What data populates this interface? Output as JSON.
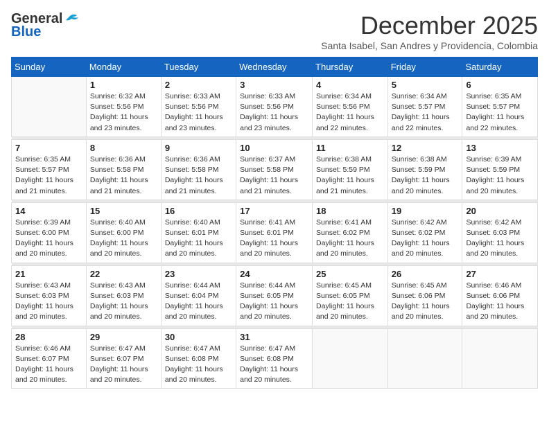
{
  "header": {
    "logo_general": "General",
    "logo_blue": "Blue",
    "month_title": "December 2025",
    "subtitle": "Santa Isabel, San Andres y Providencia, Colombia"
  },
  "weekdays": [
    "Sunday",
    "Monday",
    "Tuesday",
    "Wednesday",
    "Thursday",
    "Friday",
    "Saturday"
  ],
  "weeks": [
    [
      {
        "day": "",
        "info": ""
      },
      {
        "day": "1",
        "info": "Sunrise: 6:32 AM\nSunset: 5:56 PM\nDaylight: 11 hours\nand 23 minutes."
      },
      {
        "day": "2",
        "info": "Sunrise: 6:33 AM\nSunset: 5:56 PM\nDaylight: 11 hours\nand 23 minutes."
      },
      {
        "day": "3",
        "info": "Sunrise: 6:33 AM\nSunset: 5:56 PM\nDaylight: 11 hours\nand 23 minutes."
      },
      {
        "day": "4",
        "info": "Sunrise: 6:34 AM\nSunset: 5:56 PM\nDaylight: 11 hours\nand 22 minutes."
      },
      {
        "day": "5",
        "info": "Sunrise: 6:34 AM\nSunset: 5:57 PM\nDaylight: 11 hours\nand 22 minutes."
      },
      {
        "day": "6",
        "info": "Sunrise: 6:35 AM\nSunset: 5:57 PM\nDaylight: 11 hours\nand 22 minutes."
      }
    ],
    [
      {
        "day": "7",
        "info": "Sunrise: 6:35 AM\nSunset: 5:57 PM\nDaylight: 11 hours\nand 21 minutes."
      },
      {
        "day": "8",
        "info": "Sunrise: 6:36 AM\nSunset: 5:58 PM\nDaylight: 11 hours\nand 21 minutes."
      },
      {
        "day": "9",
        "info": "Sunrise: 6:36 AM\nSunset: 5:58 PM\nDaylight: 11 hours\nand 21 minutes."
      },
      {
        "day": "10",
        "info": "Sunrise: 6:37 AM\nSunset: 5:58 PM\nDaylight: 11 hours\nand 21 minutes."
      },
      {
        "day": "11",
        "info": "Sunrise: 6:38 AM\nSunset: 5:59 PM\nDaylight: 11 hours\nand 21 minutes."
      },
      {
        "day": "12",
        "info": "Sunrise: 6:38 AM\nSunset: 5:59 PM\nDaylight: 11 hours\nand 20 minutes."
      },
      {
        "day": "13",
        "info": "Sunrise: 6:39 AM\nSunset: 5:59 PM\nDaylight: 11 hours\nand 20 minutes."
      }
    ],
    [
      {
        "day": "14",
        "info": "Sunrise: 6:39 AM\nSunset: 6:00 PM\nDaylight: 11 hours\nand 20 minutes."
      },
      {
        "day": "15",
        "info": "Sunrise: 6:40 AM\nSunset: 6:00 PM\nDaylight: 11 hours\nand 20 minutes."
      },
      {
        "day": "16",
        "info": "Sunrise: 6:40 AM\nSunset: 6:01 PM\nDaylight: 11 hours\nand 20 minutes."
      },
      {
        "day": "17",
        "info": "Sunrise: 6:41 AM\nSunset: 6:01 PM\nDaylight: 11 hours\nand 20 minutes."
      },
      {
        "day": "18",
        "info": "Sunrise: 6:41 AM\nSunset: 6:02 PM\nDaylight: 11 hours\nand 20 minutes."
      },
      {
        "day": "19",
        "info": "Sunrise: 6:42 AM\nSunset: 6:02 PM\nDaylight: 11 hours\nand 20 minutes."
      },
      {
        "day": "20",
        "info": "Sunrise: 6:42 AM\nSunset: 6:03 PM\nDaylight: 11 hours\nand 20 minutes."
      }
    ],
    [
      {
        "day": "21",
        "info": "Sunrise: 6:43 AM\nSunset: 6:03 PM\nDaylight: 11 hours\nand 20 minutes."
      },
      {
        "day": "22",
        "info": "Sunrise: 6:43 AM\nSunset: 6:03 PM\nDaylight: 11 hours\nand 20 minutes."
      },
      {
        "day": "23",
        "info": "Sunrise: 6:44 AM\nSunset: 6:04 PM\nDaylight: 11 hours\nand 20 minutes."
      },
      {
        "day": "24",
        "info": "Sunrise: 6:44 AM\nSunset: 6:05 PM\nDaylight: 11 hours\nand 20 minutes."
      },
      {
        "day": "25",
        "info": "Sunrise: 6:45 AM\nSunset: 6:05 PM\nDaylight: 11 hours\nand 20 minutes."
      },
      {
        "day": "26",
        "info": "Sunrise: 6:45 AM\nSunset: 6:06 PM\nDaylight: 11 hours\nand 20 minutes."
      },
      {
        "day": "27",
        "info": "Sunrise: 6:46 AM\nSunset: 6:06 PM\nDaylight: 11 hours\nand 20 minutes."
      }
    ],
    [
      {
        "day": "28",
        "info": "Sunrise: 6:46 AM\nSunset: 6:07 PM\nDaylight: 11 hours\nand 20 minutes."
      },
      {
        "day": "29",
        "info": "Sunrise: 6:47 AM\nSunset: 6:07 PM\nDaylight: 11 hours\nand 20 minutes."
      },
      {
        "day": "30",
        "info": "Sunrise: 6:47 AM\nSunset: 6:08 PM\nDaylight: 11 hours\nand 20 minutes."
      },
      {
        "day": "31",
        "info": "Sunrise: 6:47 AM\nSunset: 6:08 PM\nDaylight: 11 hours\nand 20 minutes."
      },
      {
        "day": "",
        "info": ""
      },
      {
        "day": "",
        "info": ""
      },
      {
        "day": "",
        "info": ""
      }
    ]
  ]
}
